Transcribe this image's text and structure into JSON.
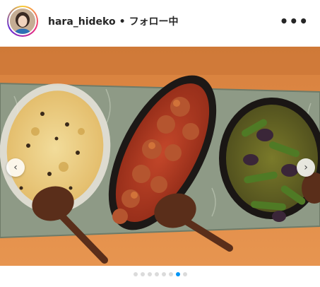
{
  "post_header": {
    "username": "hara_hideko",
    "separator": "•",
    "follow_status": "フォロー中",
    "more_glyph": "•••"
  },
  "carousel": {
    "prev_glyph": "‹",
    "next_glyph": "›",
    "slide_count": 8,
    "active_index": 6
  }
}
